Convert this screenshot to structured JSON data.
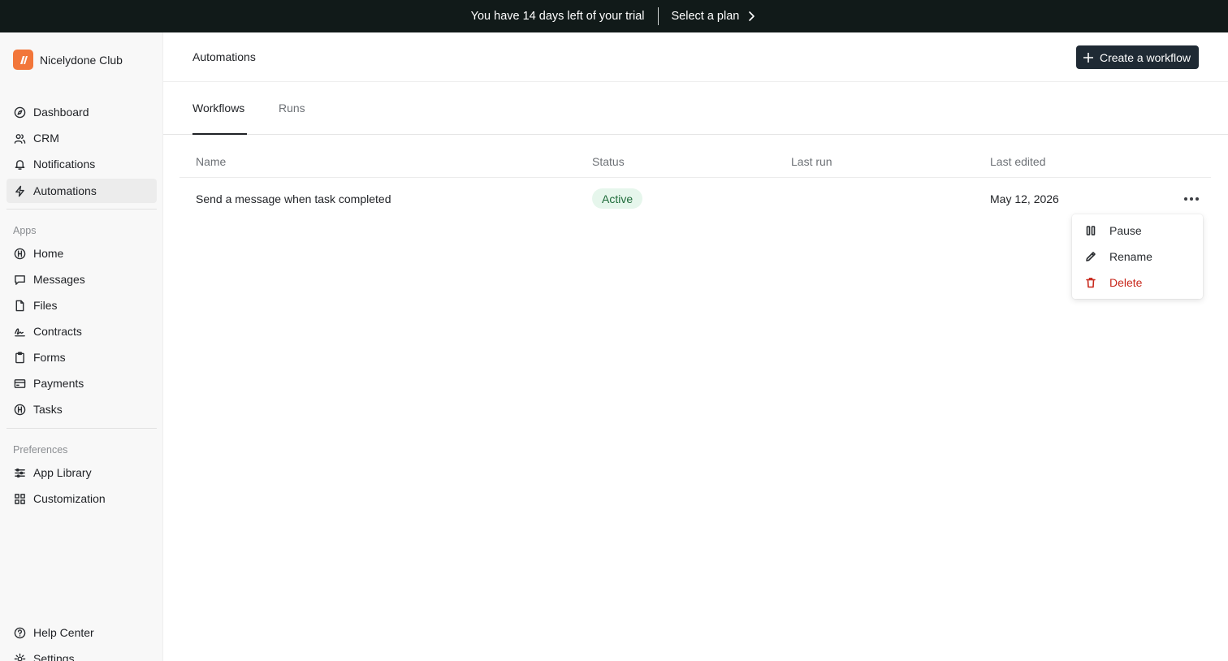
{
  "banner": {
    "message": "You have 14 days left of your trial",
    "cta": "Select a plan"
  },
  "workspace": {
    "name": "Nicelydone Club",
    "accent_color": "#f2763a"
  },
  "sidebar": {
    "main_items": [
      {
        "label": "Dashboard",
        "icon": "compass-icon"
      },
      {
        "label": "CRM",
        "icon": "users-icon"
      },
      {
        "label": "Notifications",
        "icon": "bell-icon"
      },
      {
        "label": "Automations",
        "icon": "bolt-icon",
        "active": true
      }
    ],
    "apps_label": "Apps",
    "apps": [
      {
        "label": "Home",
        "icon": "app-circle-icon"
      },
      {
        "label": "Messages",
        "icon": "chat-icon"
      },
      {
        "label": "Files",
        "icon": "file-icon"
      },
      {
        "label": "Contracts",
        "icon": "signature-icon"
      },
      {
        "label": "Forms",
        "icon": "clipboard-icon"
      },
      {
        "label": "Payments",
        "icon": "credit-card-icon"
      },
      {
        "label": "Tasks",
        "icon": "app-circle-icon"
      }
    ],
    "preferences_label": "Preferences",
    "preferences": [
      {
        "label": "App Library",
        "icon": "sliders-icon"
      },
      {
        "label": "Customization",
        "icon": "grid-icon"
      }
    ],
    "footer": [
      {
        "label": "Help Center",
        "icon": "help-icon"
      },
      {
        "label": "Settings",
        "icon": "gear-icon"
      }
    ]
  },
  "header": {
    "title": "Automations",
    "create_label": "Create a workflow"
  },
  "tabs": [
    {
      "label": "Workflows",
      "active": true
    },
    {
      "label": "Runs",
      "active": false
    }
  ],
  "table": {
    "columns": [
      "Name",
      "Status",
      "Last run",
      "Last edited"
    ],
    "rows": [
      {
        "name": "Send a message when task completed",
        "status": "Active",
        "last_run": "",
        "last_edited": "May 12, 2026"
      }
    ]
  },
  "row_menu": {
    "items": [
      {
        "label": "Pause",
        "icon": "pause-icon"
      },
      {
        "label": "Rename",
        "icon": "pencil-icon"
      },
      {
        "label": "Delete",
        "icon": "trash-icon",
        "danger": true
      }
    ]
  },
  "colors": {
    "banner_bg": "#111a19",
    "primary_button": "#1f2a34",
    "status_active_bg": "#e6f6ec",
    "status_active_text": "#1f6b3a",
    "danger": "#c8281c"
  }
}
